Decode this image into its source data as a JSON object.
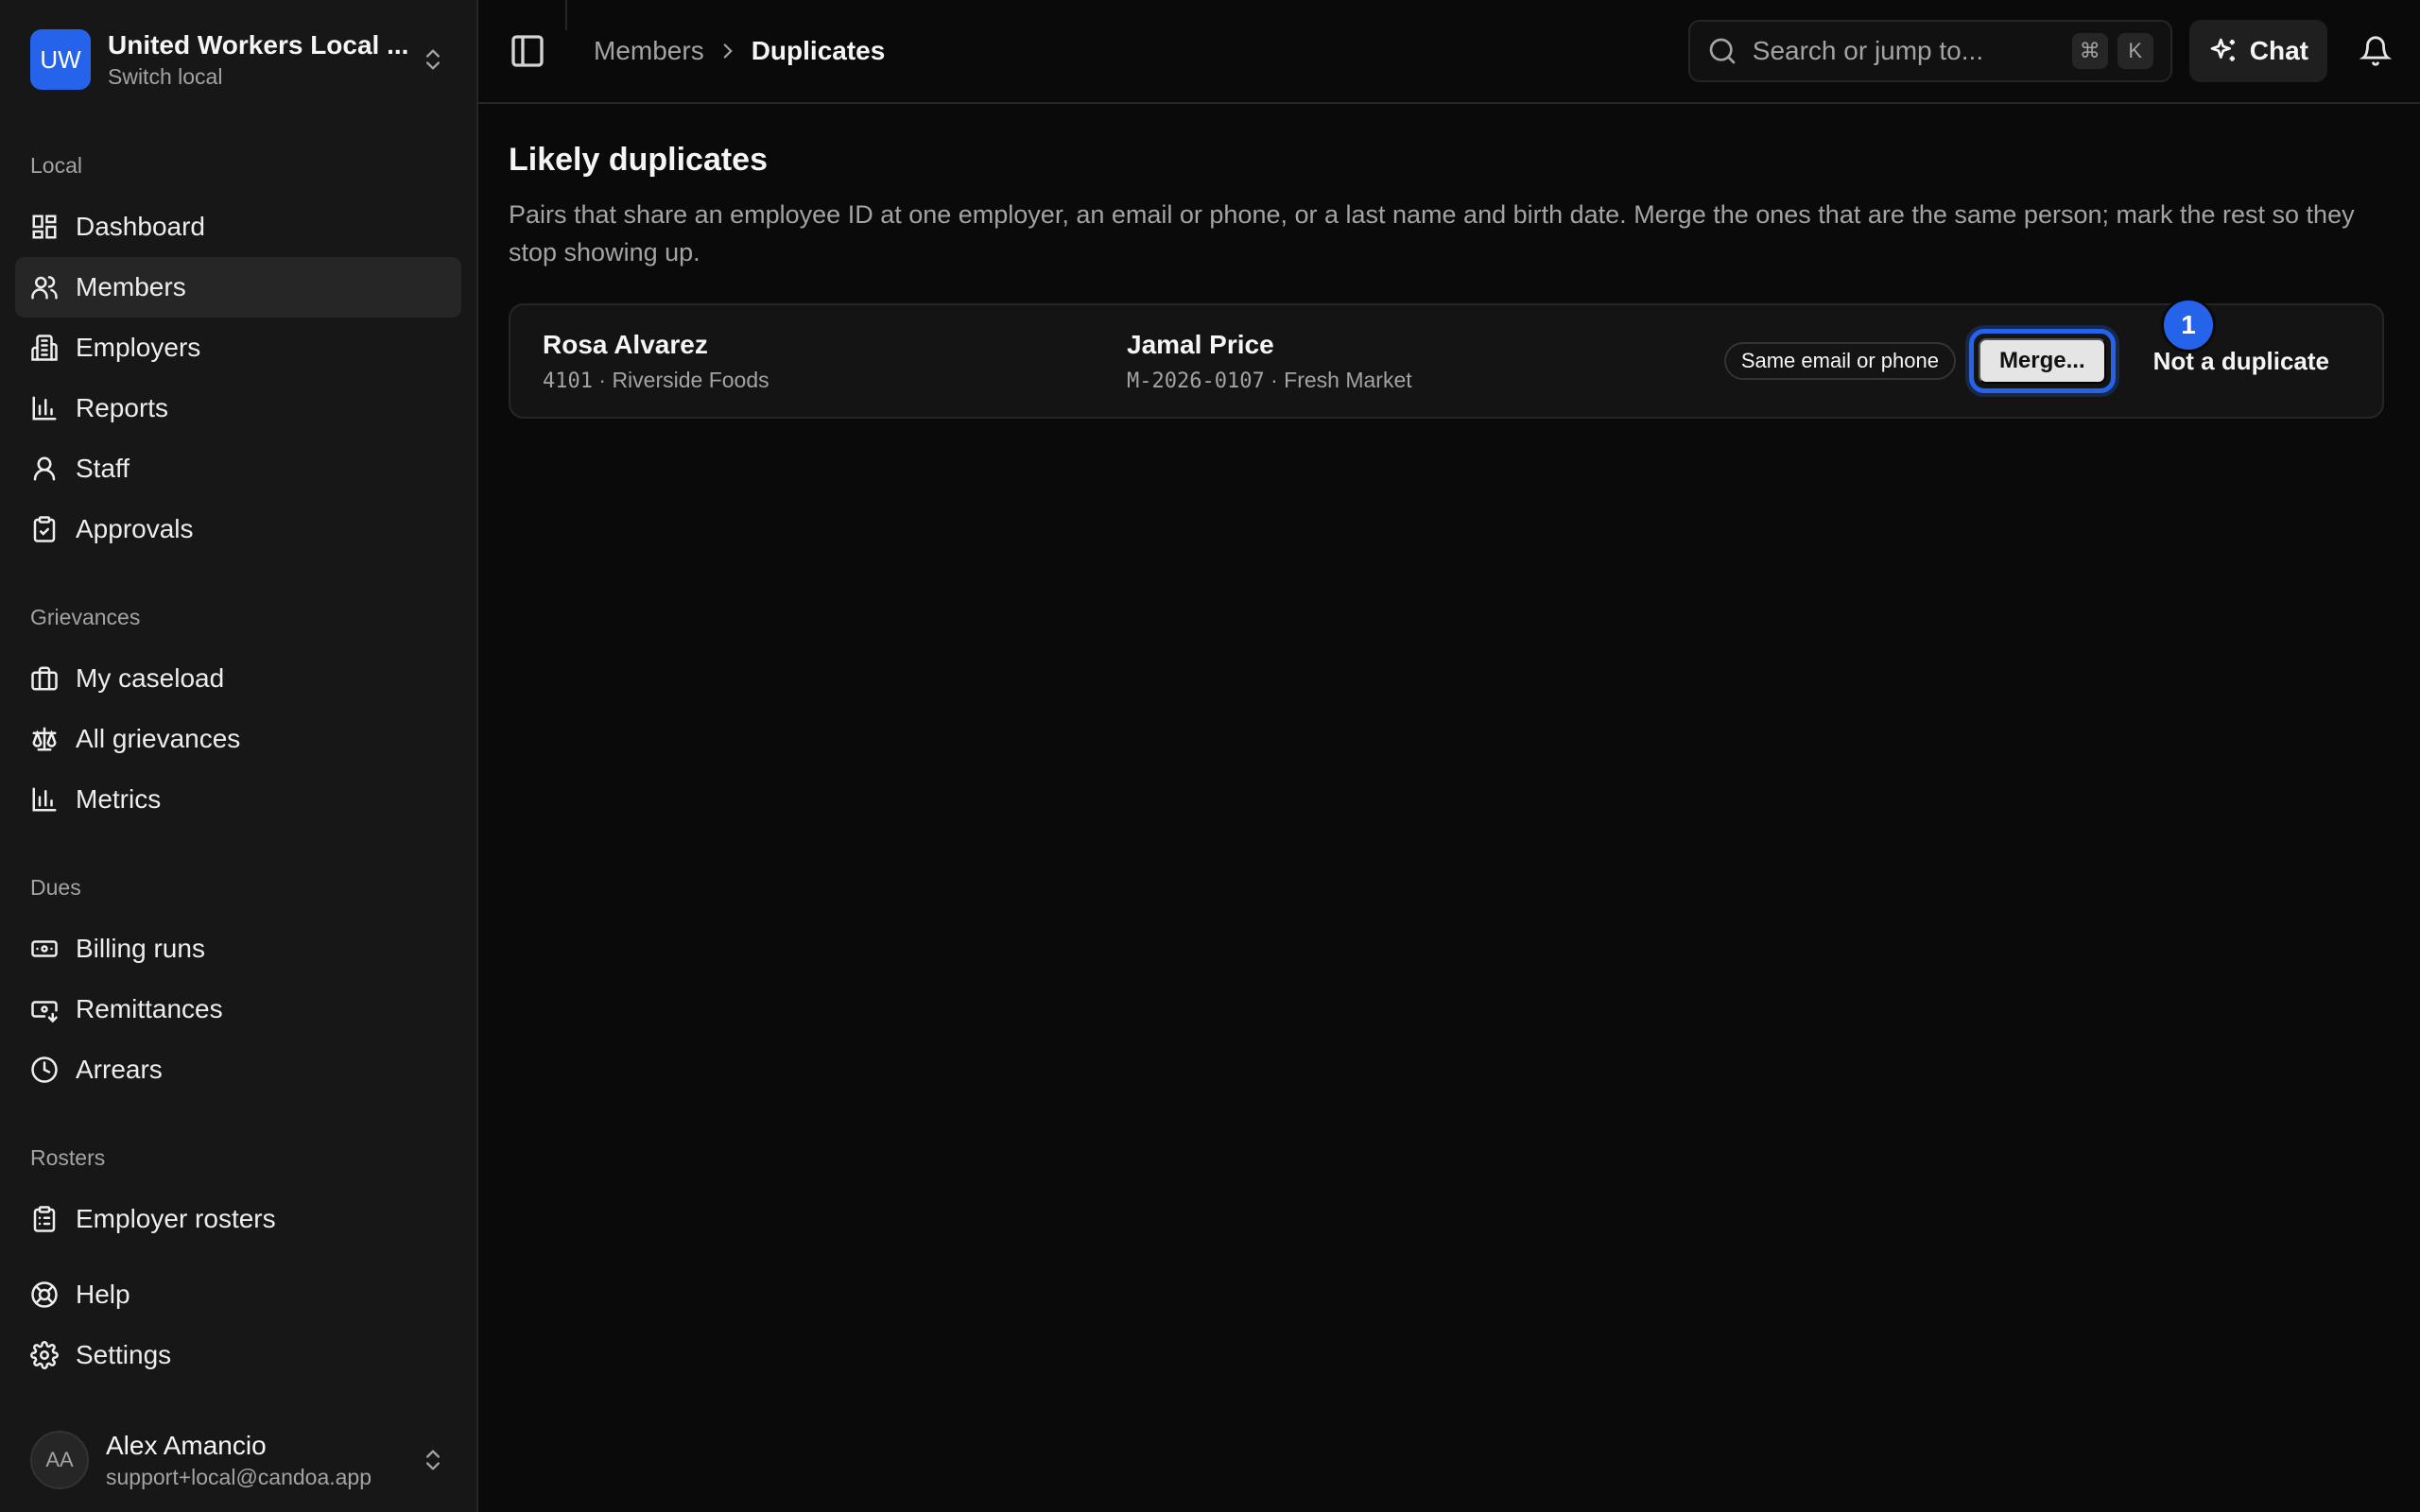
{
  "org": {
    "initials": "UW",
    "name": "United Workers Local ...",
    "switch_label": "Switch local"
  },
  "sidebar": {
    "sections": [
      {
        "label": "Local",
        "items": [
          "Dashboard",
          "Members",
          "Employers",
          "Reports",
          "Staff",
          "Approvals"
        ]
      },
      {
        "label": "Grievances",
        "items": [
          "My caseload",
          "All grievances",
          "Metrics"
        ]
      },
      {
        "label": "Dues",
        "items": [
          "Billing runs",
          "Remittances",
          "Arrears"
        ]
      },
      {
        "label": "Rosters",
        "items": [
          "Employer rosters"
        ]
      }
    ],
    "footer_items": [
      "Help",
      "Settings"
    ],
    "active_item": "Members"
  },
  "user": {
    "initials": "AA",
    "name": "Alex Amancio",
    "email": "support+local@candoa.app"
  },
  "header": {
    "breadcrumb_parent": "Members",
    "breadcrumb_current": "Duplicates",
    "search_placeholder": "Search or jump to...",
    "shortcut_cmd": "⌘",
    "shortcut_key": "K",
    "chat_label": "Chat"
  },
  "page": {
    "title": "Likely duplicates",
    "description": "Pairs that share an employee ID at one employer, an email or phone, or a last name and birth date. Merge the ones that are the same person; mark the rest so they stop showing up."
  },
  "duplicates": [
    {
      "left": {
        "name": "Rosa Alvarez",
        "id": "4101",
        "employer": "Riverside Foods"
      },
      "right": {
        "name": "Jamal Price",
        "id": "M-2026-0107",
        "employer": "Fresh Market"
      },
      "reason": "Same email or phone",
      "merge_label": "Merge...",
      "dismiss_label": "Not a duplicate",
      "badge": "1"
    }
  ],
  "colors": {
    "accent": "#2563eb",
    "background": "#0a0a0a",
    "sidebar": "#171717"
  }
}
